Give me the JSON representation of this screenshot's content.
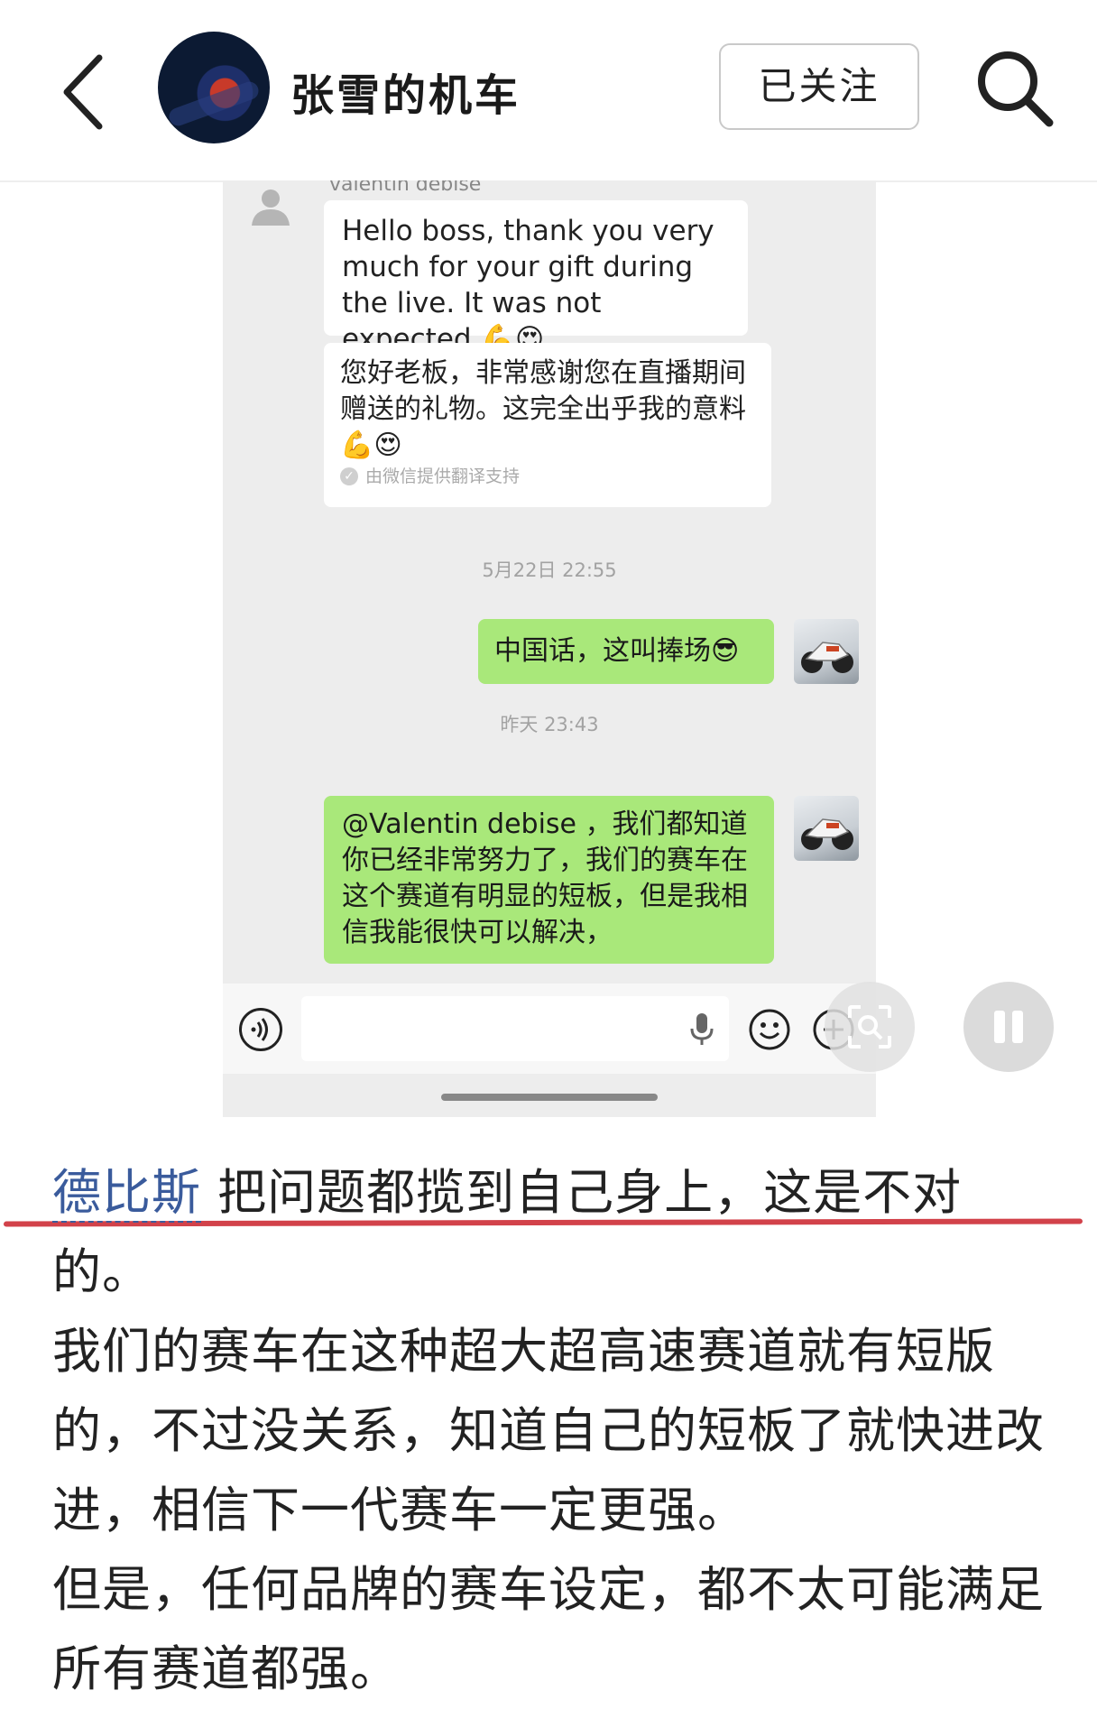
{
  "header": {
    "channel_name": "张雪的机车",
    "follow_label": "已关注"
  },
  "chat": {
    "sender_name": "valentin debise",
    "message_english": "Hello boss, thank you very much for your gift during the live. It was not expected 💪😍",
    "message_translation": "您好老板，非常感谢您在直播期间赠送的礼物。这完全出乎我的意料💪😍",
    "translation_note": "由微信提供翻译支持",
    "time_1": "5月22日 22:55",
    "reply_1": "中国话，这叫捧场😎",
    "time_2": "昨天 23:43",
    "reply_2": "@Valentin debise ，我们都知道你已经非常努力了，我们的赛车在这个赛道有明显的短板，但是我相信我能很快可以解决，"
  },
  "article": {
    "mention": "德比斯",
    "line_1_rest": "把问题都揽到自己身上，这是不对的。",
    "paragraph_1": "我们的赛车在这种超大超高速赛道就有短版的，不过没关系，知道自己的短板了就快进改进，相信下一代赛车一定更强。",
    "paragraph_2": "但是，任何品牌的赛车设定，都不太可能满足所有赛道都强。"
  },
  "colors": {
    "my_bubble": "#a9e87a",
    "mention": "#3a5b9c",
    "highlight_line": "#d2424a"
  },
  "icons": [
    "back-arrow-icon",
    "search-icon",
    "voice-icon",
    "mic-icon",
    "emoji-icon",
    "plus-icon",
    "scan-icon",
    "pause-icon"
  ]
}
